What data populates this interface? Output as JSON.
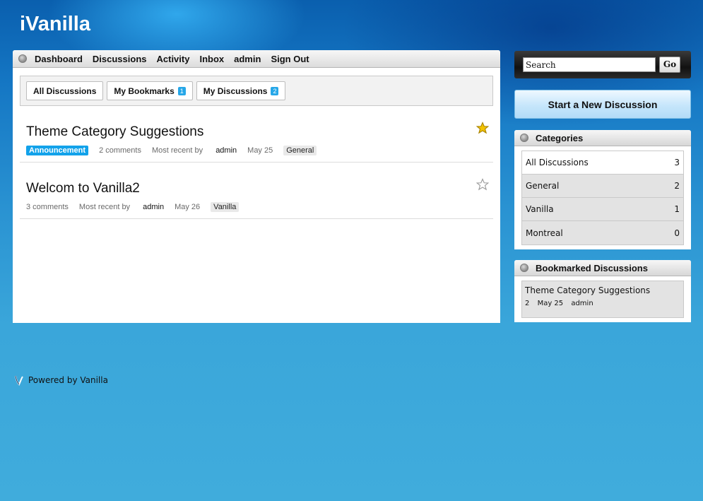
{
  "site": {
    "title": "iVanilla"
  },
  "menu": {
    "items": [
      "Dashboard",
      "Discussions",
      "Activity",
      "Inbox",
      "admin",
      "Sign Out"
    ]
  },
  "tabs": {
    "all_discussions": "All Discussions",
    "my_bookmarks": "My Bookmarks",
    "my_bookmarks_count": "1",
    "my_discussions": "My Discussions",
    "my_discussions_count": "2"
  },
  "discussions": [
    {
      "title": "Theme Category Suggestions",
      "badge": "Announcement",
      "comments": "2 comments",
      "most_recent_label": "Most recent by",
      "author": "admin",
      "date": "May 25",
      "category": "General",
      "bookmarked": true
    },
    {
      "title": "Welcom to Vanilla2",
      "comments": "3 comments",
      "most_recent_label": "Most recent by",
      "author": "admin",
      "date": "May 26",
      "category": "Vanilla",
      "bookmarked": false
    }
  ],
  "search": {
    "placeholder": "Search",
    "value": "Search",
    "button": "Go"
  },
  "start_button": "Start a New Discussion",
  "categories": {
    "heading": "Categories",
    "items": [
      {
        "name": "All Discussions",
        "count": "3"
      },
      {
        "name": "General",
        "count": "2"
      },
      {
        "name": "Vanilla",
        "count": "1"
      },
      {
        "name": "Montreal",
        "count": "0"
      }
    ]
  },
  "bookmarked": {
    "heading": "Bookmarked Discussions",
    "items": [
      {
        "title": "Theme Category Suggestions",
        "count": "2",
        "date": "May 25",
        "author": "admin"
      }
    ]
  },
  "footer": {
    "text": "Powered by Vanilla"
  },
  "colors": {
    "accent": "#26a7e8",
    "announcement": "#12a2ea",
    "star": "#f2c200"
  }
}
